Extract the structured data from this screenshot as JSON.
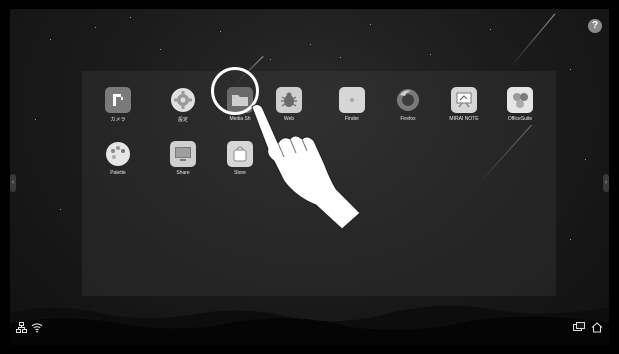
{
  "apps": [
    {
      "label": "カメラ",
      "icon": "camera-icon"
    },
    {
      "label": "設定",
      "icon": "settings-gear-icon"
    },
    {
      "label": "Media Sh",
      "icon": "folder-icon"
    },
    {
      "label": "Web",
      "icon": "bug-icon"
    },
    {
      "label": "Finder",
      "icon": "finder-icon"
    },
    {
      "label": "Firefox",
      "icon": "firefox-icon"
    },
    {
      "label": "MIRAI NOTE",
      "icon": "whiteboard-icon"
    },
    {
      "label": "OfficeSuite",
      "icon": "hexagons-icon"
    },
    {
      "label": "Palette",
      "icon": "palette-icon"
    },
    {
      "label": "Share",
      "icon": "monitor-icon"
    },
    {
      "label": "Store",
      "icon": "shopping-bag-icon"
    }
  ],
  "help_label": "?",
  "status": {
    "left_icons": [
      "network-icon",
      "wifi-icon"
    ],
    "right_icons": [
      "screen-mirror-icon",
      "home-icon"
    ]
  },
  "colors": {
    "bezel": "#000000",
    "icon_tile": "#d9d9d9",
    "icon_glyph": "#6a6a6a"
  }
}
